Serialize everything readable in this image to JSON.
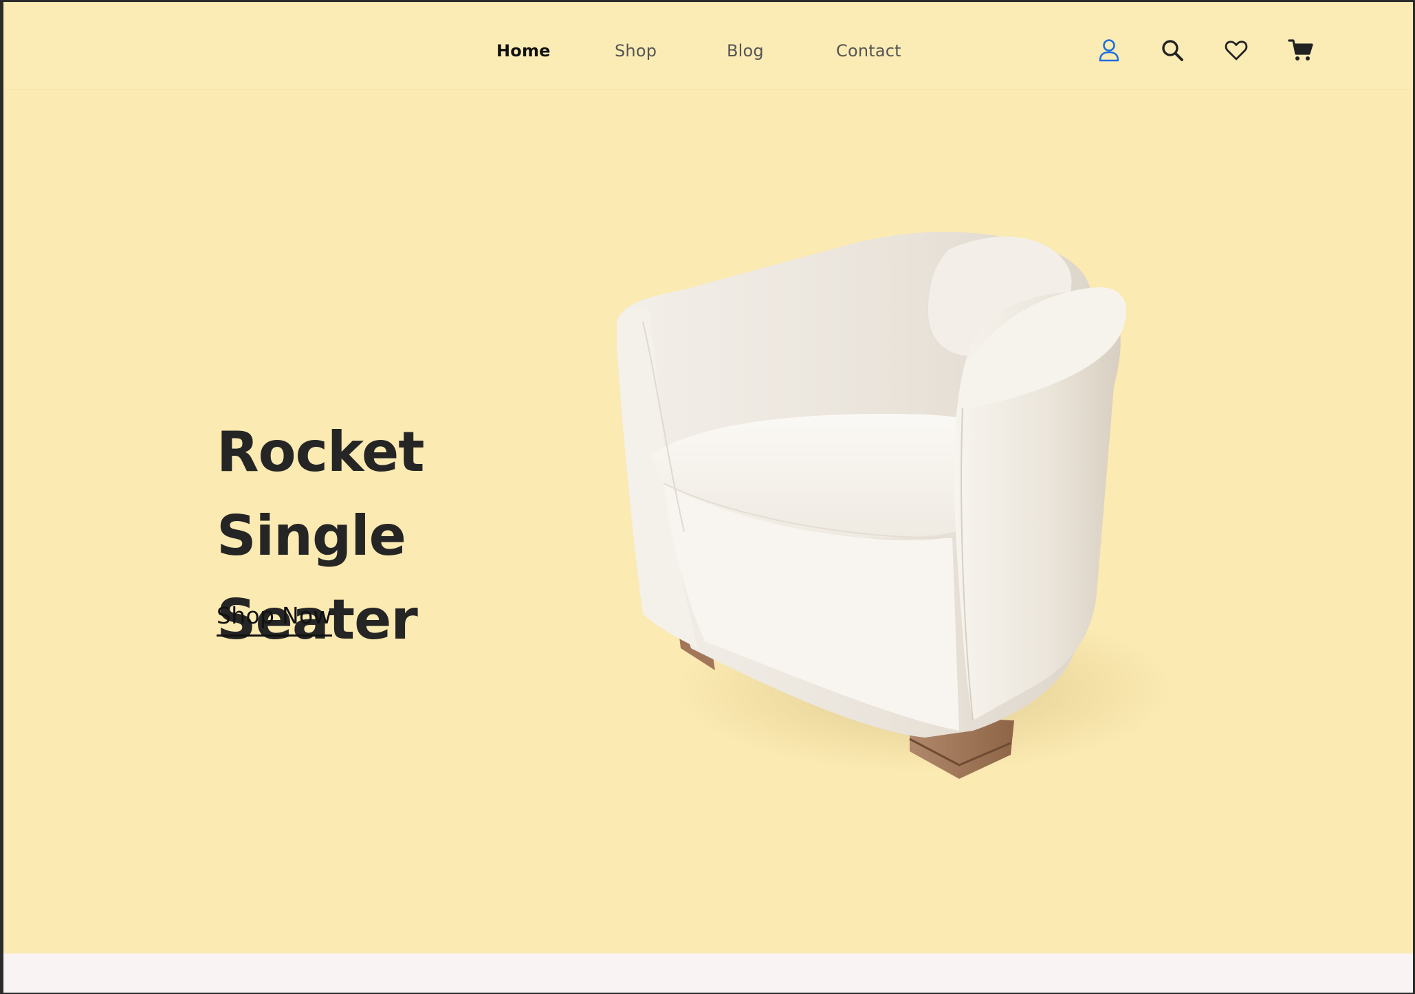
{
  "nav": {
    "items": [
      {
        "label": "Home",
        "active": true
      },
      {
        "label": "Shop",
        "active": false
      },
      {
        "label": "Blog",
        "active": false
      },
      {
        "label": "Contact",
        "active": false
      }
    ]
  },
  "header_icons": [
    {
      "name": "user-icon",
      "color": "#1a6fe0"
    },
    {
      "name": "search-icon",
      "color": "#222222"
    },
    {
      "name": "heart-icon",
      "color": "#222222"
    },
    {
      "name": "cart-icon",
      "color": "#222222"
    }
  ],
  "hero": {
    "title_line1": "Rocket Single",
    "title_line2": "Seater",
    "cta_label": "Shop Now",
    "image": "armchair"
  },
  "colors": {
    "background": "#fbeab1",
    "text": "#252525",
    "accent_icon": "#1a6fe0",
    "footer_strip": "#faf3f3"
  }
}
